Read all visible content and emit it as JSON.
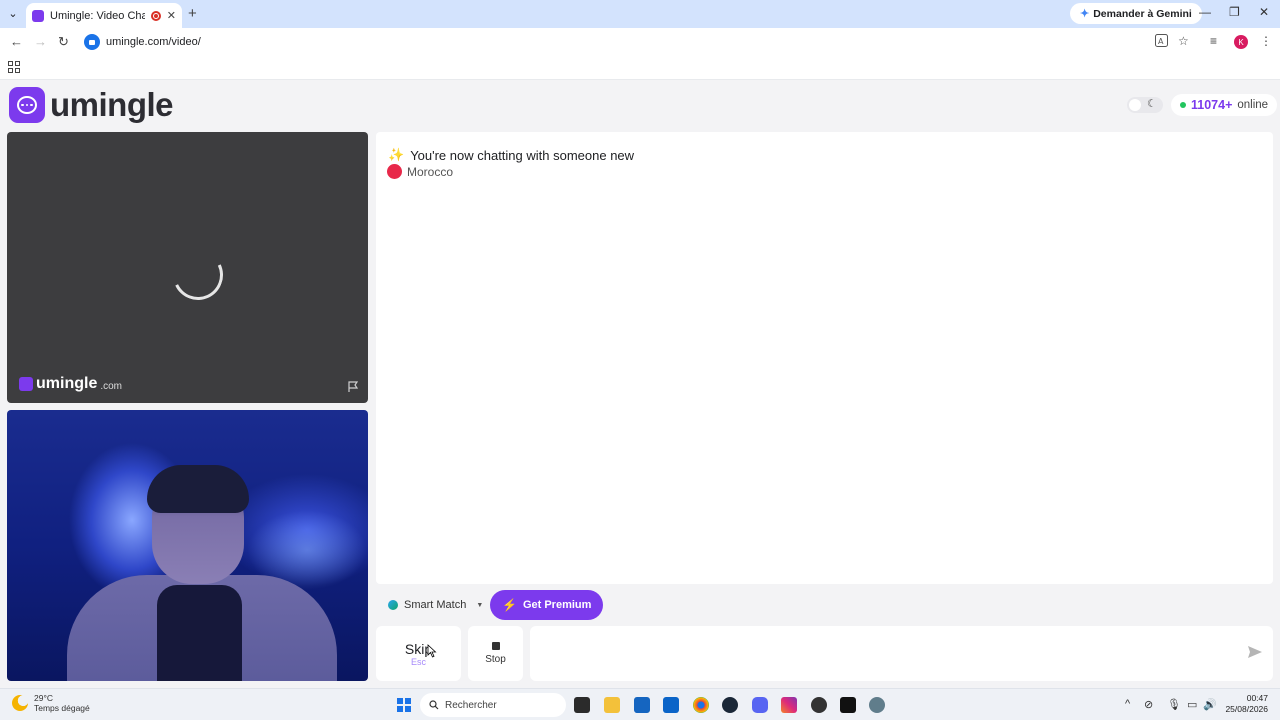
{
  "browser": {
    "tab_title": "Umingle: Video Chat with S",
    "new_tab": "+",
    "gemini_label": "Demander à Gemini",
    "url": "umingle.com/video/",
    "profile_initial": "K"
  },
  "site": {
    "logo_text": "umingle",
    "online_count": "11074+",
    "online_label": "online"
  },
  "remote_video": {
    "watermark": "umingle",
    "watermark_domain": ".com"
  },
  "chat": {
    "status": "You're now chatting with someone new",
    "country": "Morocco"
  },
  "controls": {
    "smart_match": "Smart Match",
    "premium": "Get Premium",
    "skip": "Skip",
    "skip_key": "Esc",
    "stop": "Stop",
    "message_placeholder": ""
  },
  "taskbar": {
    "temperature": "29°C",
    "weather": "Temps dégagé",
    "search": "Rechercher",
    "time": "00:47",
    "date": "25/08/2026"
  },
  "colors": {
    "brand": "#7c3aed",
    "online_dot": "#22c55e",
    "morocco_flag": "#e8294a"
  }
}
